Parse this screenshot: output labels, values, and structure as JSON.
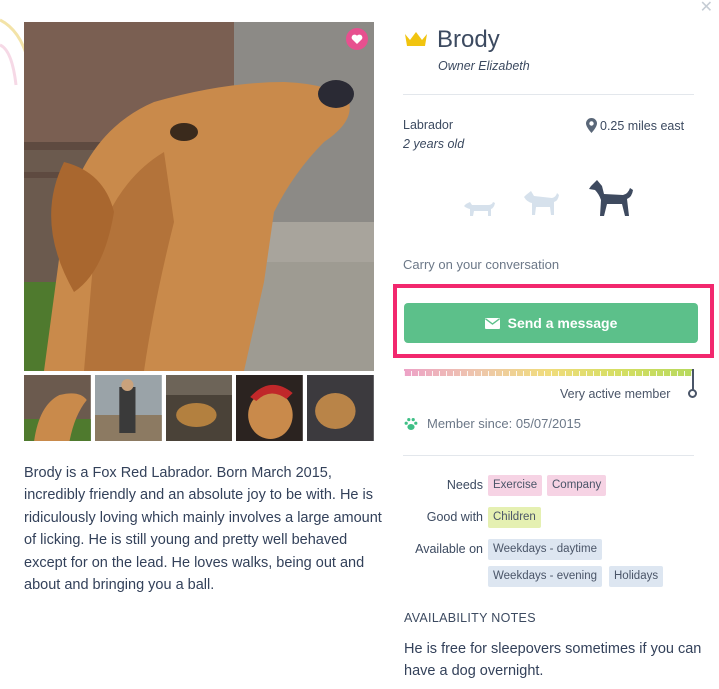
{
  "profile": {
    "name": "Brody",
    "owner": "Owner Elizabeth",
    "breed": "Labrador",
    "age": "2 years old",
    "distance": "0.25 miles east",
    "size_options": [
      "small-dog-icon",
      "medium-dog-icon",
      "large-dog-icon"
    ],
    "selected_size": "large-dog-icon"
  },
  "conversation": {
    "label": "Carry on your conversation",
    "send_button": "Send a message"
  },
  "activity": {
    "level_fraction": 1.0,
    "label": "Very active member"
  },
  "member_since": "Member since: 05/07/2015",
  "bio": "Brody is a Fox Red Labrador. Born March 2015, incredibly friendly and an absolute joy to be with. He is ridiculously loving which mainly involves a large amount of licking. He is still young and pretty well behaved except for on the lead. He loves walks, being out and about and bringing you a ball.",
  "details": {
    "needs_label": "Needs",
    "needs": [
      "Exercise",
      "Company"
    ],
    "good_with_label": "Good with",
    "good_with": [
      "Children"
    ],
    "available_label": "Available on",
    "available": [
      "Weekdays - daytime",
      "Weekdays - evening",
      "Holidays"
    ]
  },
  "notes": {
    "title": "AVAILABILITY NOTES",
    "text": "He is free for sleepovers sometimes if you can have a dog overnight."
  },
  "colors": {
    "accent_green": "#5cc08a",
    "highlight_pink": "#f2286e",
    "heart_pink": "#e7508f",
    "crown_gold": "#f1c40f"
  }
}
